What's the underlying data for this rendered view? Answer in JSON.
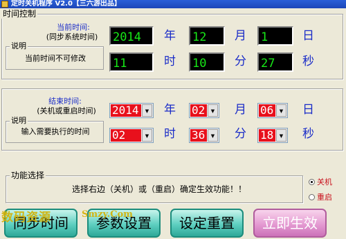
{
  "window": {
    "title": "定时关机程序 V2.0【三六游出品】"
  },
  "time_control": {
    "legend": "时间控制",
    "label_line1": "当前时间:",
    "label_line2": "(同步系统时间)",
    "note_legend": "说明",
    "note_text": "当前时间不可修改",
    "year": "2014",
    "month": "12",
    "day": "1",
    "hour": "11",
    "minute": "10",
    "second": "27",
    "unit_year": "年",
    "unit_month": "月",
    "unit_day": "日",
    "unit_hour": "时",
    "unit_minute": "分",
    "unit_second": "秒"
  },
  "end_time": {
    "label_line1": "结束时间:",
    "label_line2": "(关机或重启时间)",
    "note_legend": "说明",
    "note_text": "输入需要执行的时间",
    "year": "2014",
    "month": "02",
    "day": "06",
    "hour": "02",
    "minute": "36",
    "second": "18",
    "unit_year": "年",
    "unit_month": "月",
    "unit_day": "日",
    "unit_hour": "时",
    "unit_minute": "分",
    "unit_second": "秒"
  },
  "function": {
    "legend": "功能选择",
    "text": "选择右边（关机）或（重启）确定生效功能！！",
    "options": [
      {
        "label": "关机",
        "selected": true
      },
      {
        "label": "重启",
        "selected": false
      }
    ]
  },
  "buttons": {
    "sync": "同步时间",
    "params": "参数设置",
    "reset": "设定重置",
    "apply": "立即生效"
  },
  "watermark": {
    "cn": "数码资源",
    "en": "Smzy.Com"
  },
  "colors": {
    "accent_red": "#e8101c",
    "lcd_green": "#17e817",
    "label_blue": "#1a2cc8"
  }
}
